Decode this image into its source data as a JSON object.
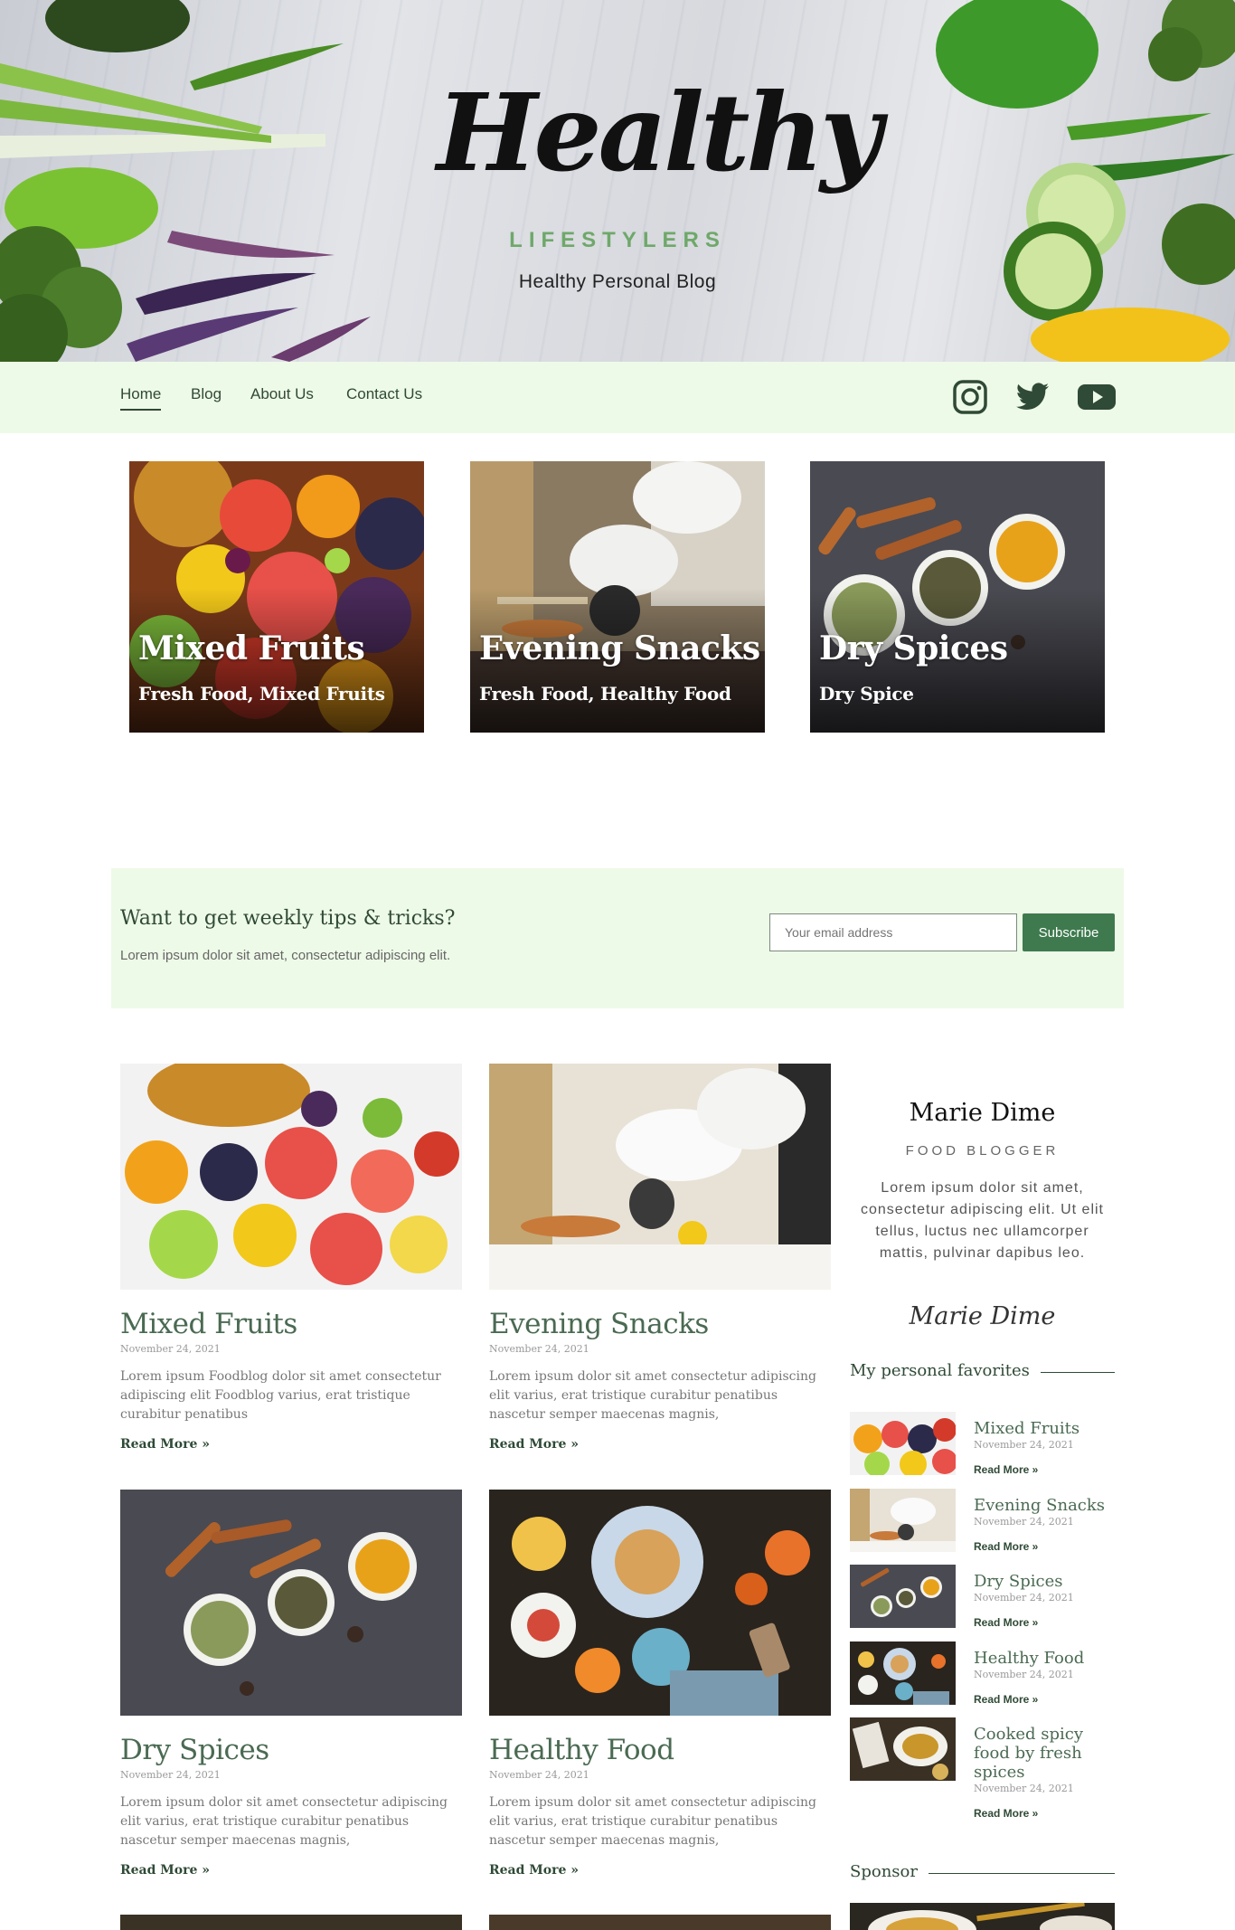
{
  "header": {
    "logo_script": "Healthy",
    "logo_sub": "LIFESTYLERS",
    "tagline": "Healthy Personal Blog"
  },
  "nav": {
    "items": [
      {
        "label": "Home",
        "active": true
      },
      {
        "label": "Blog",
        "active": false
      },
      {
        "label": "About Us",
        "active": false
      },
      {
        "label": "Contact Us",
        "active": false
      }
    ],
    "social": [
      "instagram-icon",
      "twitter-icon",
      "youtube-icon"
    ]
  },
  "featured": [
    {
      "title": "Mixed Fruits",
      "subtitle": "Fresh Food, Mixed Fruits"
    },
    {
      "title": "Evening Snacks",
      "subtitle": "Fresh Food, Healthy Food"
    },
    {
      "title": "Dry Spices",
      "subtitle": "Dry Spice"
    }
  ],
  "newsletter": {
    "heading": "Want to get weekly tips & tricks?",
    "text": "Lorem ipsum dolor sit amet, consectetur adipiscing elit.",
    "placeholder": "Your email address",
    "button": "Subscribe"
  },
  "posts": [
    {
      "title": "Mixed Fruits",
      "date": "November 24, 2021",
      "excerpt": "Lorem ipsum Foodblog dolor sit amet consectetur adipiscing elit Foodblog varius, erat tristique curabitur penatibus",
      "read_more": "Read More »"
    },
    {
      "title": "Evening Snacks",
      "date": "November 24, 2021",
      "excerpt": "Lorem ipsum dolor sit amet consectetur adipiscing elit varius, erat tristique curabitur penatibus nascetur semper maecenas magnis,",
      "read_more": "Read More »"
    },
    {
      "title": "Dry Spices",
      "date": "November 24, 2021",
      "excerpt": "Lorem ipsum dolor sit amet consectetur adipiscing elit varius, erat tristique curabitur penatibus nascetur semper maecenas magnis,",
      "read_more": "Read More »"
    },
    {
      "title": "Healthy Food",
      "date": "November 24, 2021",
      "excerpt": "Lorem ipsum dolor sit amet consectetur adipiscing elit varius, erat tristique curabitur penatibus nascetur semper maecenas magnis,",
      "read_more": "Read More »"
    }
  ],
  "sidebar": {
    "name": "Marie Dime",
    "role": "FOOD BLOGGER",
    "bio": "Lorem ipsum dolor sit amet, consectetur adipiscing elit. Ut elit tellus, luctus nec ullamcorper mattis, pulvinar dapibus leo.",
    "signature": "Marie Dime",
    "favorites_heading": "My personal favorites",
    "favorites": [
      {
        "title": "Mixed Fruits",
        "date": "November 24, 2021",
        "read_more": "Read More »"
      },
      {
        "title": "Evening Snacks",
        "date": "November 24, 2021",
        "read_more": "Read More »"
      },
      {
        "title": "Dry Spices",
        "date": "November 24, 2021",
        "read_more": "Read More »"
      },
      {
        "title": "Healthy Food",
        "date": "November 24, 2021",
        "read_more": "Read More »"
      },
      {
        "title": "Cooked spicy food by fresh spices",
        "date": "November 24, 2021",
        "read_more": "Read More »"
      }
    ],
    "sponsor_heading": "Sponsor"
  },
  "colors": {
    "accent": "#3f7a4e",
    "nav_bg": "#eefae8",
    "heading_green": "#4a6a52"
  }
}
